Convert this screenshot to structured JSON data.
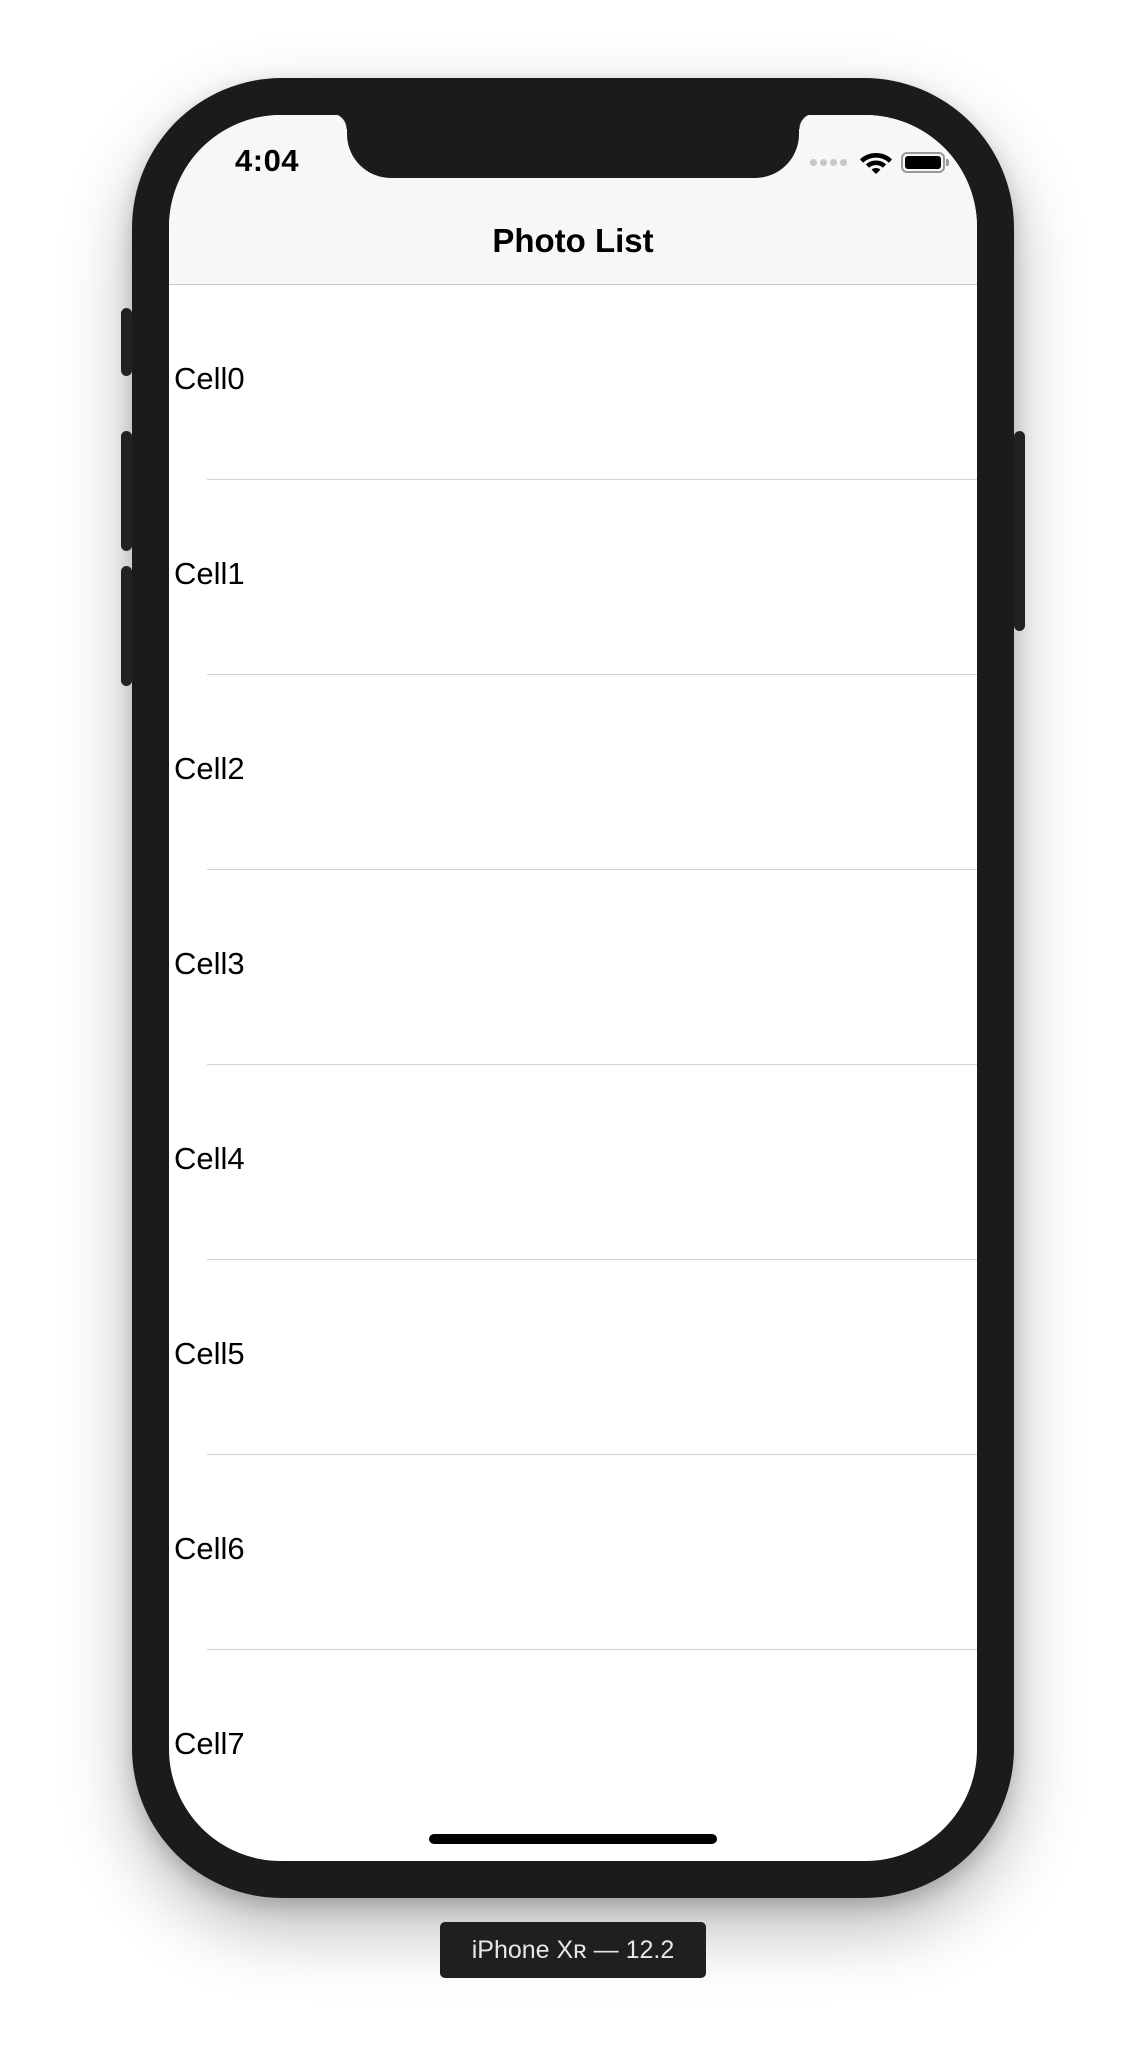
{
  "status_bar": {
    "time": "4:04",
    "icons": [
      "cellular-signal-icon",
      "wifi-icon",
      "battery-icon"
    ]
  },
  "navbar": {
    "title": "Photo List"
  },
  "cells": [
    {
      "label": "Cell0"
    },
    {
      "label": "Cell1"
    },
    {
      "label": "Cell2"
    },
    {
      "label": "Cell3"
    },
    {
      "label": "Cell4"
    },
    {
      "label": "Cell5"
    },
    {
      "label": "Cell6"
    },
    {
      "label": "Cell7"
    }
  ],
  "simulator": {
    "device_label": "iPhone Xʀ — 12.2"
  },
  "colors": {
    "device_frame": "#1b1b1b",
    "navbar_background": "#f7f7f7",
    "separator": "#d1d1d6",
    "label_background": "#1f1f1f"
  }
}
